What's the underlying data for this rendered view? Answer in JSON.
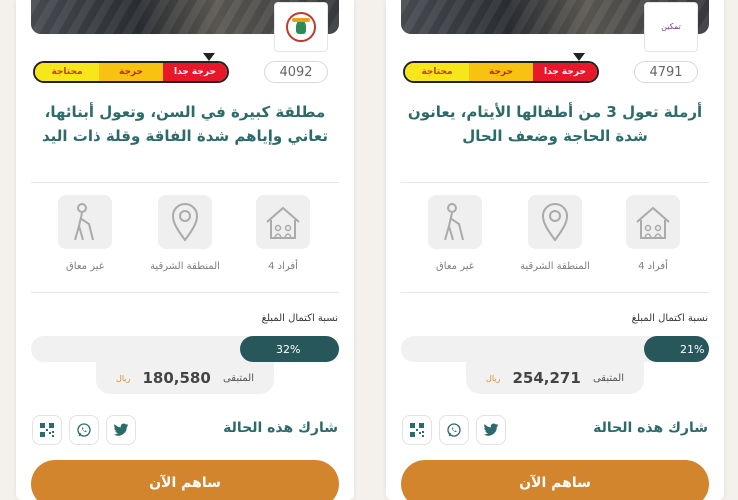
{
  "colors": {
    "accent_teal": "#2d6b6b",
    "progress_fill": "#27575a",
    "cta_orange": "#d3852e",
    "need_very": "#e8172a",
    "need_mid": "#f7c210",
    "need_low": "#f7e61a"
  },
  "cards": [
    {
      "logo_text": "",
      "need_levels": {
        "very": "حرجة جدا",
        "mid": "حرجة",
        "low": "محتاجة"
      },
      "case_id": "4092",
      "title": "مطلقة كبيرة في السن، وتعول أبنائها، تعاني وإياهم شدة الفاقة وقلة ذات اليد",
      "stats": {
        "members": "4 أفراد",
        "region": "المنطقة الشرقية",
        "disability": "غير معاق"
      },
      "progress_label": "نسبة اكتمال المبلغ",
      "progress_percent_text": "32%",
      "progress_fraction": 0.32,
      "remaining_label": "المتبقى",
      "remaining_value": "180,580",
      "currency": "ريال",
      "share_label": "شارك هذه الحالة",
      "cta_label": "ساهم الآن"
    },
    {
      "logo_text": "تمكين",
      "need_levels": {
        "very": "حرجة جدا",
        "mid": "حرجة",
        "low": "محتاجة"
      },
      "case_id": "4791",
      "title": "أرملة تعول 3 من أطفالها الأيتام، يعانون شدة الحاجة وضعف الحال",
      "stats": {
        "members": "4 أفراد",
        "region": "المنطقة الشرقية",
        "disability": "غير معاق"
      },
      "progress_label": "نسبة اكتمال المبلغ",
      "progress_percent_text": "21%",
      "progress_fraction": 0.21,
      "remaining_label": "المتبقى",
      "remaining_value": "254,271",
      "currency": "ريال",
      "share_label": "شارك هذه الحالة",
      "cta_label": "ساهم الآن"
    }
  ]
}
